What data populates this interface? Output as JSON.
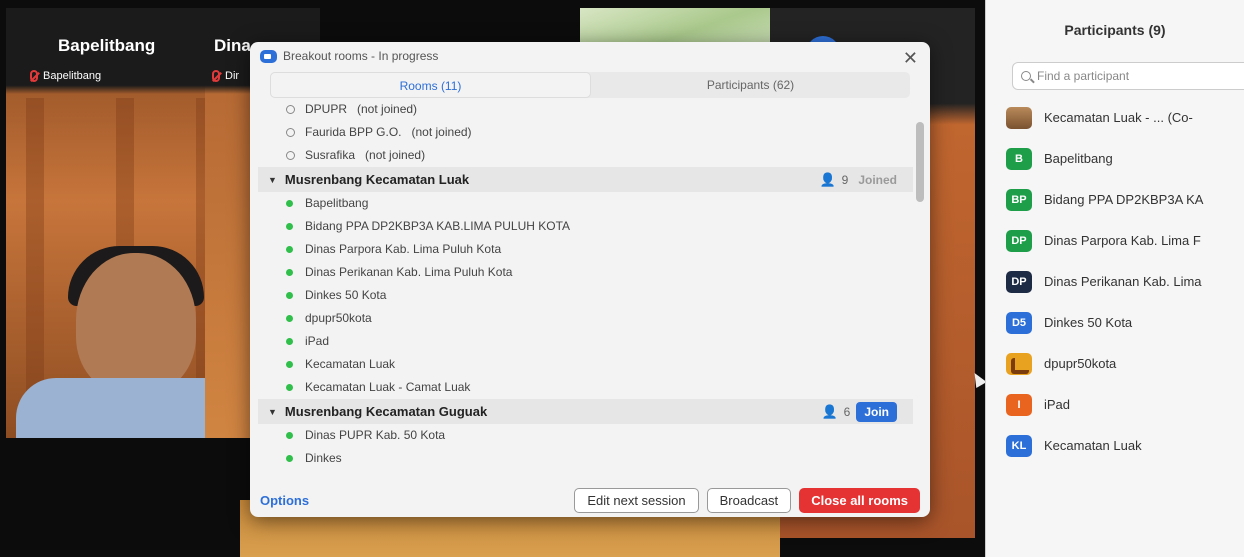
{
  "video": {
    "tiles": [
      {
        "name": "Bapelitbang",
        "sub": "Bapelitbang"
      },
      {
        "name": "Dina",
        "sub": "Dir"
      }
    ]
  },
  "dialog": {
    "title": "Breakout rooms - In progress",
    "tabs": [
      {
        "label": "Rooms (11)"
      },
      {
        "label": "Participants (62)"
      }
    ],
    "unassigned": [
      {
        "name": "DPUPR",
        "status": "(not joined)"
      },
      {
        "name": "Faurida BPP G.O.",
        "status": "(not joined)"
      },
      {
        "name": "Susrafika",
        "status": "(not joined)"
      }
    ],
    "rooms": [
      {
        "name": "Musrenbang Kecamatan Luak",
        "count": "9",
        "state": "Joined",
        "members": [
          "Bapelitbang",
          "Bidang PPA DP2KBP3A KAB.LIMA PULUH KOTA",
          "Dinas Parpora Kab. Lima Puluh Kota",
          "Dinas Perikanan Kab. Lima Puluh Kota",
          "Dinkes 50 Kota",
          "dpupr50kota",
          "iPad",
          "Kecamatan Luak",
          "Kecamatan Luak - Camat Luak"
        ]
      },
      {
        "name": "Musrenbang Kecamatan Guguak",
        "count": "6",
        "state": "Join",
        "members": [
          "Dinas PUPR Kab. 50 Kota",
          "Dinkes"
        ]
      }
    ],
    "footer": {
      "options": "Options",
      "edit_next": "Edit next session",
      "broadcast": "Broadcast",
      "close_all": "Close all rooms"
    }
  },
  "panel": {
    "title": "Participants (9)",
    "search_placeholder": "Find a participant",
    "participants": [
      {
        "avatar": "",
        "avatar_type": "photo",
        "color": "",
        "name": "Kecamatan Luak - ... (Co-"
      },
      {
        "avatar": "B",
        "avatar_type": "initials",
        "color": "#1f9e4a",
        "name": "Bapelitbang"
      },
      {
        "avatar": "BP",
        "avatar_type": "initials",
        "color": "#1f9e4a",
        "name": "Bidang PPA DP2KBP3A KA"
      },
      {
        "avatar": "DP",
        "avatar_type": "initials",
        "color": "#1f9e4a",
        "name": "Dinas Parpora Kab. Lima F"
      },
      {
        "avatar": "DP",
        "avatar_type": "initials",
        "color": "#1d2b44",
        "name": "Dinas Perikanan Kab. Lima"
      },
      {
        "avatar": "D5",
        "avatar_type": "initials",
        "color": "#2d6fd8",
        "name": "Dinkes 50 Kota"
      },
      {
        "avatar": "",
        "avatar_type": "logo",
        "color": "#e8a21f",
        "name": "dpupr50kota"
      },
      {
        "avatar": "I",
        "avatar_type": "initials",
        "color": "#e8641f",
        "name": "iPad"
      },
      {
        "avatar": "KL",
        "avatar_type": "initials",
        "color": "#2d6fd8",
        "name": "Kecamatan Luak"
      }
    ]
  }
}
